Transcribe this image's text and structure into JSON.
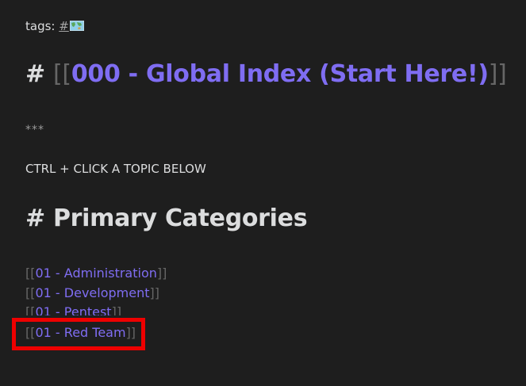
{
  "tags": {
    "label": "tags: ",
    "hash": "#",
    "icon": "world-map-icon"
  },
  "title": {
    "hash": "#",
    "open": "[[",
    "link": "000 - Global Index (Start Here!)",
    "close": "]]"
  },
  "divider": "***",
  "instruction": "CTRL + CLICK A TOPIC BELOW",
  "categories_heading": "# Primary Categories",
  "categories": [
    {
      "open": "[[",
      "label": "01 - Administration",
      "close": "]]"
    },
    {
      "open": "[[",
      "label": "01 - Development",
      "close": "]]"
    },
    {
      "open": "[[",
      "label": "01 - Pentest",
      "close": "]]"
    },
    {
      "open": "[[",
      "label": "01 - Red Team",
      "close": "]]"
    }
  ],
  "colors": {
    "background": "#1e1e1e",
    "text": "#dcddde",
    "link": "#7f6df2",
    "bracket": "#666666",
    "highlight": "#ee0000"
  }
}
